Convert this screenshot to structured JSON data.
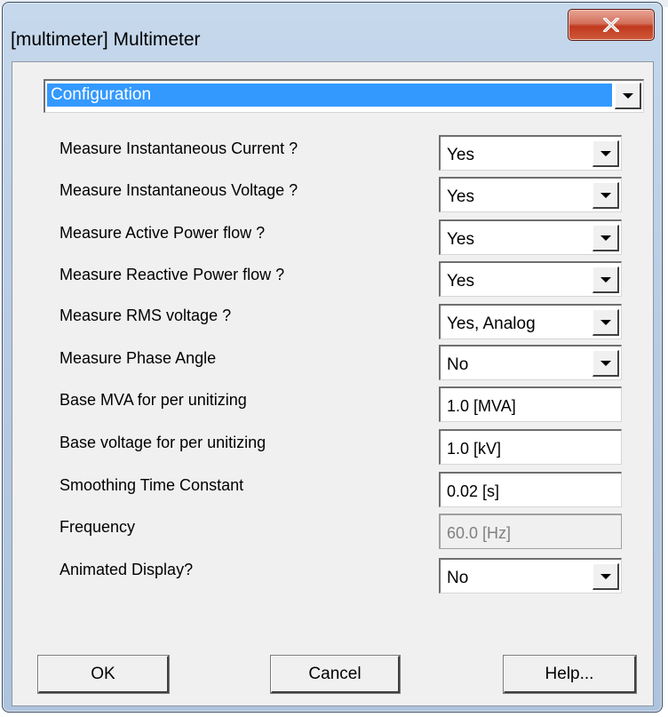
{
  "window": {
    "title": "[multimeter] Multimeter"
  },
  "config_dropdown": {
    "value": "Configuration"
  },
  "params": [
    {
      "label": "Measure Instantaneous Current ?",
      "type": "dropdown",
      "value": "Yes"
    },
    {
      "label": "Measure Instantaneous Voltage ?",
      "type": "dropdown",
      "value": "Yes"
    },
    {
      "label": "Measure Active Power flow ?",
      "type": "dropdown",
      "value": "Yes"
    },
    {
      "label": "Measure Reactive Power flow ?",
      "type": "dropdown",
      "value": "Yes"
    },
    {
      "label": "Measure RMS voltage ?",
      "type": "dropdown",
      "value": "Yes, Analog"
    },
    {
      "label": "Measure Phase Angle",
      "type": "dropdown",
      "value": "No"
    },
    {
      "label": "Base MVA for per unitizing",
      "type": "text",
      "value": "1.0 [MVA]"
    },
    {
      "label": "Base voltage for per unitizing",
      "type": "text",
      "value": "1.0 [kV]"
    },
    {
      "label": "Smoothing Time Constant",
      "type": "text",
      "value": "0.02 [s]"
    },
    {
      "label": "Frequency",
      "type": "text",
      "value": "60.0 [Hz]",
      "disabled": true
    },
    {
      "label": "Animated Display?",
      "type": "dropdown",
      "value": "No"
    }
  ],
  "buttons": {
    "ok": "OK",
    "cancel": "Cancel",
    "help": "Help..."
  },
  "icons": {
    "close": "close-icon",
    "dropdown_arrow": "chevron-down-icon"
  },
  "colors": {
    "selection": "#3399ff",
    "close_button": "#c0391e",
    "frame": "#b7cbe3"
  }
}
